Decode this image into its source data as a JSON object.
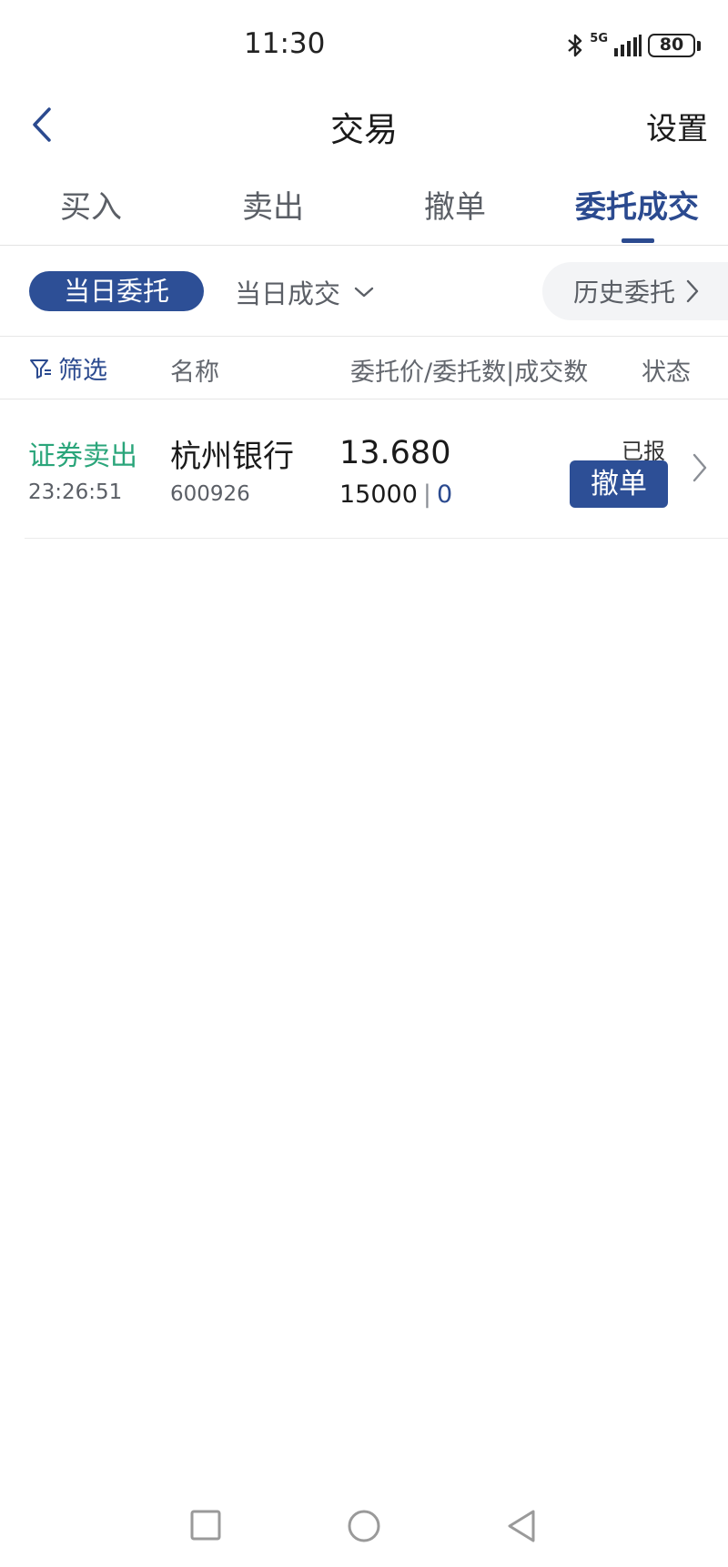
{
  "status_bar": {
    "time": "11:30",
    "network": "5G",
    "battery": "80"
  },
  "header": {
    "title": "交易",
    "settings_label": "设置"
  },
  "tabs": [
    {
      "label": "买入",
      "active": false
    },
    {
      "label": "卖出",
      "active": false
    },
    {
      "label": "撤单",
      "active": false
    },
    {
      "label": "委托成交",
      "active": true
    }
  ],
  "subtabs": {
    "active_label": "当日委托",
    "dropdown_label": "当日成交",
    "history_label": "历史委托"
  },
  "columns": {
    "filter_label": "筛选",
    "name": "名称",
    "price_qty": "委托价/委托数|成交数",
    "status": "状态"
  },
  "orders": [
    {
      "type": "证券卖出",
      "time": "23:26:51",
      "name": "杭州银行",
      "code": "600926",
      "price": "13.680",
      "quantity": "15000",
      "filled": "0",
      "status": "已报",
      "action_label": "撤单"
    }
  ],
  "colors": {
    "accent": "#2d4f96",
    "sell_green": "#2aa57a",
    "muted_text": "#5b5f66"
  }
}
